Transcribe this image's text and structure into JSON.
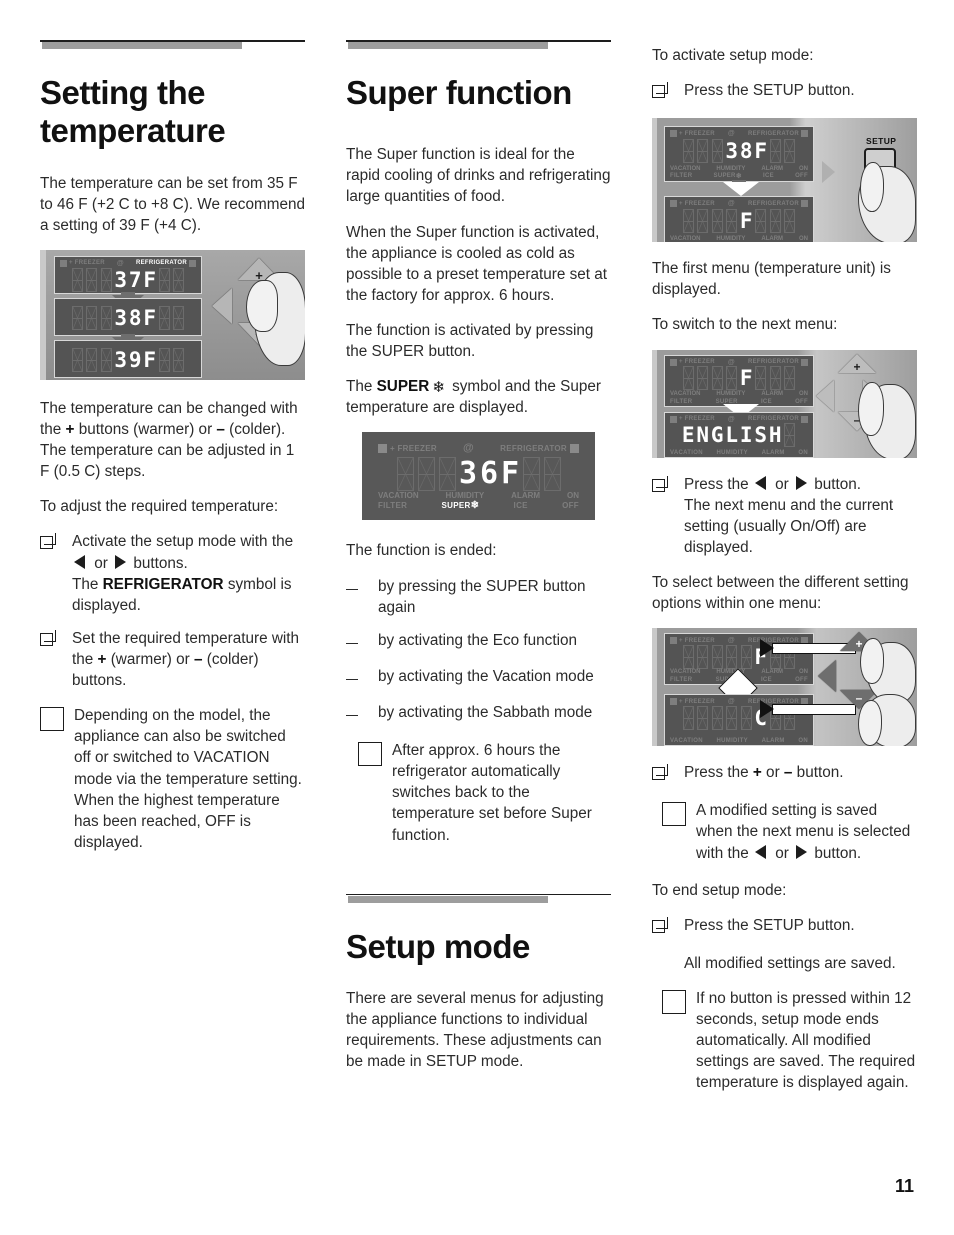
{
  "page": {
    "number": "11"
  },
  "col1": {
    "heading": "Setting the temperature",
    "p1": "The temperature can be set from 35 F to 46 F (+2 C to +8 C). We recommend a setting of 39 F (+4 C).",
    "figure": {
      "name": "temperature-change-display",
      "panel_top_labels": [
        "FREEZER",
        "@",
        "REFRIGERATOR"
      ],
      "readings": [
        "37F",
        "38F",
        "39F"
      ],
      "pad_buttons": [
        "+",
        "◀",
        "−"
      ]
    },
    "p2": "The temperature can be changed with the + buttons (warmer) or – (colder). The temperature can be adjusted in 1 F (0.5 C) steps.",
    "p2_bold_plus": "+",
    "p2_bold_minus": "–",
    "p3": "To adjust the required temperature:",
    "bullets": [
      {
        "marker": "square",
        "pre": "Activate the setup mode with the ",
        "mid": " or ",
        "post": " buttons.",
        "line2_pre": "The ",
        "line2_bold": "REFRIGERATOR",
        "line2_post": " symbol is displayed."
      },
      {
        "marker": "square",
        "pre": "Set the required temperature with the ",
        "bold1": "+",
        "mid": " (warmer) or ",
        "bold2": "–",
        "post": " (colder) buttons."
      }
    ],
    "note": "Depending on the model, the appliance can also be switched off or switched to VACATION mode via the temperature setting. When the highest temperature has been reached, OFF is displayed."
  },
  "col2": {
    "heading": "Super function",
    "p1": "The Super function is ideal for the rapid cooling of drinks and refrigerating large quantities of food.",
    "p2": "When the Super function is activated, the appliance is cooled as cold as possible to a preset temperature set at the factory for approx. 6 hours.",
    "p3": "The function is activated by pressing the SUPER button.",
    "p4_pre": "The ",
    "p4_bold": "SUPER",
    "p4_symbol": "❄",
    "p4_post": " symbol and the Super temperature are displayed.",
    "figure": {
      "name": "super-function-display",
      "top_labels": [
        "FREEZER",
        "@",
        "REFRIGERATOR"
      ],
      "reading": "36F",
      "bottom_row1": [
        "VACATION",
        "HUMIDITY",
        "ALARM",
        "ON"
      ],
      "bottom_row2": [
        "FILTER",
        "SUPER❄",
        "ICE",
        "OFF"
      ]
    },
    "p5": "The function is ended:",
    "dashes": [
      "by pressing the SUPER button again",
      "by activating the Eco function",
      "by activating the Vacation mode",
      "by activating the Sabbath mode"
    ],
    "note": "After approx. 6 hours the refrigerator automatically switches back to the temperature set before Super function.",
    "heading2": "Setup mode",
    "p6": "There are several menus for adjusting the appliance functions to individual requirements. These adjustments can be made in SETUP mode."
  },
  "col3": {
    "p1": "To activate setup mode:",
    "bullet1": "Press the SETUP button.",
    "figure1": {
      "name": "setup-button-display",
      "reading_top": "38F",
      "reading_bottom": "F",
      "key_label": "SETUP"
    },
    "p2": "The first menu (temperature unit) is displayed.",
    "p3": "To switch to the next menu:",
    "figure2": {
      "name": "next-menu-display",
      "reading_top": "F",
      "reading_bottom": "ENGLISH",
      "pad_buttons": [
        "+",
        "◀",
        "▶",
        "−"
      ]
    },
    "bullet2_pre": "Press the ",
    "bullet2_mid": " or ",
    "bullet2_post": " button.",
    "bullet2_line2": "The next menu and the current setting (usually On/Off) are displayed.",
    "p4": "To select between the different setting options within one menu:",
    "figure3": {
      "name": "setting-option-display",
      "reading_top": "F",
      "reading_bottom": "C",
      "pad_buttons": [
        "+",
        "◀",
        "−"
      ]
    },
    "bullet3_pre": "Press the ",
    "bullet3_bold1": "+",
    "bullet3_mid": " or ",
    "bullet3_bold2": "–",
    "bullet3_post": " button.",
    "note1_pre": "A modified setting is saved when the next menu is selected with the ",
    "note1_mid": " or ",
    "note1_post": " button.",
    "p5": "To end setup mode:",
    "bullet4": "Press the SETUP button.",
    "p6": "All modified settings are saved.",
    "note2": "If no button is pressed within 12 seconds, setup mode ends automatically. All modified settings are saved. The required temperature is displayed again."
  }
}
